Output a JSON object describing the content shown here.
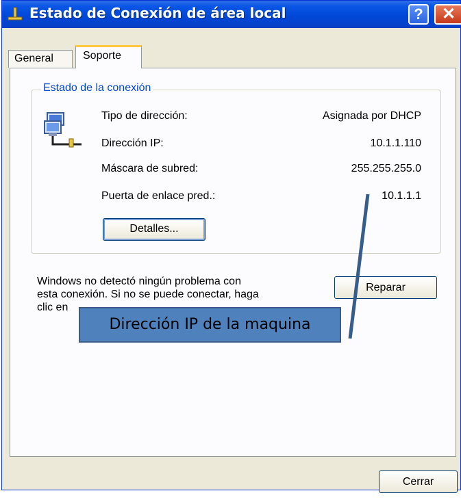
{
  "window": {
    "title": "Estado de Conexión de área local",
    "help_label": "?",
    "close_label": "✕"
  },
  "tabs": [
    {
      "label": "General",
      "active": false
    },
    {
      "label": "Soporte",
      "active": true
    }
  ],
  "connection_group": {
    "legend": "Estado de la conexión",
    "rows": [
      {
        "label": "Tipo de dirección:",
        "value": "Asignada por DHCP"
      },
      {
        "label": "Dirección IP:",
        "value": "10.1.1.110"
      },
      {
        "label": "Máscara de subred:",
        "value": "255.255.255.0"
      },
      {
        "label": "Puerta de enlace pred.:",
        "value": "10.1.1.1"
      }
    ],
    "details_button": "Detalles..."
  },
  "message": "Windows no detectó ningún problema con\nesta conexión. Si no se puede conectar, haga\nclic en",
  "repair_button": "Reparar",
  "close_button": "Cerrar",
  "annotation": {
    "text": "Dirección IP de la maquina",
    "fill_color": "#4f81bd"
  },
  "colors": {
    "titlebar": "#0047d6",
    "group_legend": "#0046d5",
    "tab_highlight": "#ffc83c"
  }
}
